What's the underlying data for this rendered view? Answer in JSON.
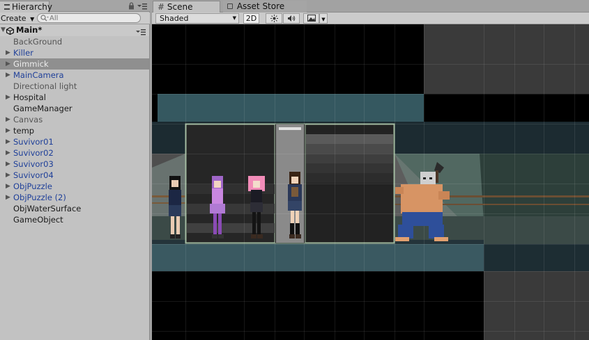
{
  "hierarchy": {
    "tab_label": "Hierarchy",
    "create_label": "Create",
    "search_placeholder": "All",
    "scene_name": "Main*",
    "items": [
      {
        "label": "BackGround",
        "color": "gray",
        "expandable": false
      },
      {
        "label": "Killer",
        "color": "blue",
        "expandable": true
      },
      {
        "label": "Gimmick",
        "color": "gray",
        "expandable": true,
        "selected": true
      },
      {
        "label": "MainCamera",
        "color": "blue",
        "expandable": true
      },
      {
        "label": "Directional light",
        "color": "gray",
        "expandable": false
      },
      {
        "label": "Hospital",
        "color": "dark",
        "expandable": true
      },
      {
        "label": "GameManager",
        "color": "dark",
        "expandable": false
      },
      {
        "label": "Canvas",
        "color": "gray",
        "expandable": true
      },
      {
        "label": "temp",
        "color": "dark",
        "expandable": true
      },
      {
        "label": "Suvivor01",
        "color": "blue",
        "expandable": true
      },
      {
        "label": "Suvivor02",
        "color": "blue",
        "expandable": true
      },
      {
        "label": "Suvivor03",
        "color": "blue",
        "expandable": true
      },
      {
        "label": "Suvivor04",
        "color": "blue",
        "expandable": true
      },
      {
        "label": "ObjPuzzle",
        "color": "blue",
        "expandable": true
      },
      {
        "label": "ObjPuzzle (2)",
        "color": "blue",
        "expandable": true
      },
      {
        "label": "ObjWaterSurface",
        "color": "dark",
        "expandable": false
      },
      {
        "label": "GameObject",
        "color": "dark",
        "expandable": false
      }
    ]
  },
  "scene": {
    "tab_scene": "Scene",
    "tab_asset_store": "Asset Store",
    "shading_mode": "Shaded",
    "mode_2d": "2D"
  },
  "colors": {
    "panel_bg": "#c2c2c2",
    "selection": "#8f8f8f",
    "prefab_blue": "#1e3f99",
    "water": "#3a5961",
    "dark_water": "#1d2c33",
    "stone": "#6a6a6a",
    "elevator_dark": "#1f1f1f"
  }
}
